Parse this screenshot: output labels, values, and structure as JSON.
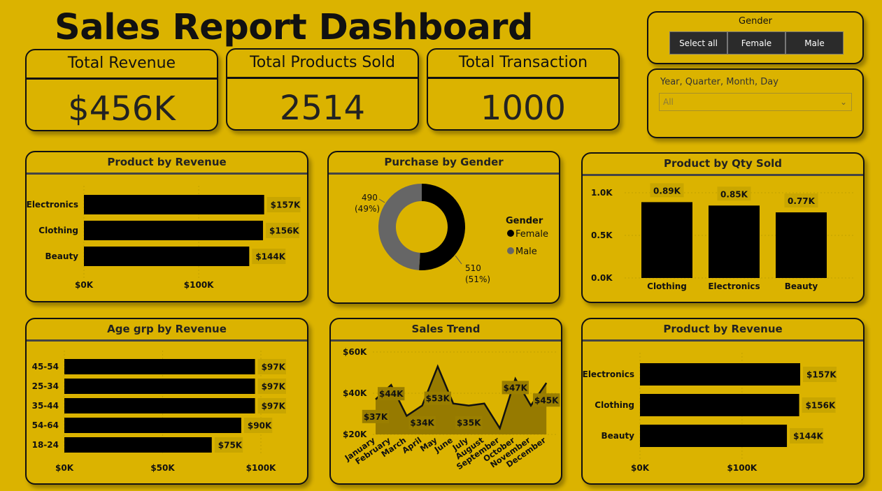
{
  "title": "Sales Report Dashboard",
  "kpis": {
    "revenue": {
      "label": "Total Revenue",
      "value": "$456K"
    },
    "products": {
      "label": "Total Products Sold",
      "value": "2514"
    },
    "transactions": {
      "label": "Total Transaction",
      "value": "1000"
    }
  },
  "gender_slicer": {
    "title": "Gender",
    "options": [
      "Select all",
      "Female",
      "Male"
    ]
  },
  "date_slicer": {
    "label": "Year, Quarter, Month, Day",
    "value": "All"
  },
  "colors": {
    "background": "#dbb300",
    "bar": "#000000",
    "label_bg": "#c9a600",
    "male": "#666666"
  },
  "chart_data": [
    {
      "id": "product-revenue-1",
      "type": "bar",
      "orientation": "horizontal",
      "title": "Product by Revenue",
      "categories": [
        "Electronics",
        "Clothing",
        "Beauty"
      ],
      "values": [
        157,
        156,
        144
      ],
      "labels": [
        "$157K",
        "$156K",
        "$144K"
      ],
      "xticks": [
        "$0K",
        "$100K"
      ],
      "xlim": [
        0,
        170
      ]
    },
    {
      "id": "gender-donut",
      "type": "pie",
      "title": "Purchase by Gender",
      "legend_title": "Gender",
      "categories": [
        "Female",
        "Male"
      ],
      "values": [
        510,
        490
      ],
      "labels": [
        [
          "510",
          "(51%)"
        ],
        [
          "490",
          "(49%)"
        ]
      ],
      "colors": [
        "#000000",
        "#666666"
      ]
    },
    {
      "id": "qty-sold",
      "type": "bar",
      "title": "Product by Qty Sold",
      "categories": [
        "Clothing",
        "Electronics",
        "Beauty"
      ],
      "values": [
        0.89,
        0.85,
        0.77
      ],
      "labels": [
        "0.89K",
        "0.85K",
        "0.77K"
      ],
      "yticks": [
        "0.0K",
        "0.5K",
        "1.0K"
      ],
      "ylim": [
        0,
        1.0
      ]
    },
    {
      "id": "age-revenue",
      "type": "bar",
      "orientation": "horizontal",
      "title": "Age grp by Revenue",
      "categories": [
        "45-54",
        "25-34",
        "35-44",
        "54-64",
        "18-24"
      ],
      "values": [
        97,
        97,
        97,
        90,
        75
      ],
      "labels": [
        "$97K",
        "$97K",
        "$97K",
        "$90K",
        "$75K"
      ],
      "xticks": [
        "$0K",
        "$50K",
        "$100K"
      ],
      "xlim": [
        0,
        100
      ]
    },
    {
      "id": "sales-trend",
      "type": "area",
      "title": "Sales Trend",
      "x": [
        "January",
        "February",
        "March",
        "April",
        "May",
        "June",
        "July",
        "August",
        "September",
        "October",
        "November",
        "December"
      ],
      "values": [
        37,
        44,
        29,
        34,
        53,
        35,
        34,
        35,
        23,
        47,
        34,
        45
      ],
      "point_labels": {
        "0": "$37K",
        "1": "$44K",
        "3": "$34K",
        "4": "$53K",
        "6": "$35K",
        "9": "$47K",
        "11": "$45K"
      },
      "yticks": [
        "$20K",
        "$40K",
        "$60K"
      ],
      "ylim": [
        20,
        60
      ]
    },
    {
      "id": "product-revenue-2",
      "type": "bar",
      "orientation": "horizontal",
      "title": "Product by Revenue",
      "categories": [
        "Electronics",
        "Clothing",
        "Beauty"
      ],
      "values": [
        157,
        156,
        144
      ],
      "labels": [
        "$157K",
        "$156K",
        "$144K"
      ],
      "xticks": [
        "$0K",
        "$100K"
      ],
      "xlim": [
        0,
        170
      ]
    }
  ]
}
